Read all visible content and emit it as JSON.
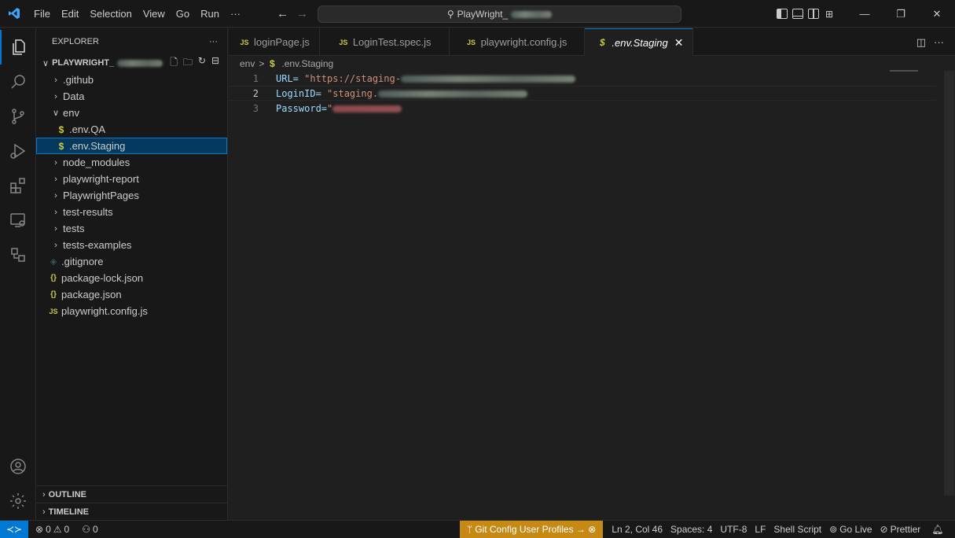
{
  "titlebar": {
    "menu": [
      "File",
      "Edit",
      "Selection",
      "View",
      "Go",
      "Run",
      "···"
    ],
    "search_text": "PlayWright_"
  },
  "sidebar": {
    "header": "EXPLORER",
    "header_more": "···",
    "project_name": "PLAYWRIGHT_",
    "tree": [
      {
        "label": ".github",
        "kind": "folder",
        "expanded": false
      },
      {
        "label": "Data",
        "kind": "folder",
        "expanded": false
      },
      {
        "label": "env",
        "kind": "folder",
        "expanded": true
      },
      {
        "label": ".env.QA",
        "kind": "env-file"
      },
      {
        "label": ".env.Staging",
        "kind": "env-file",
        "selected": true
      },
      {
        "label": "node_modules",
        "kind": "folder",
        "expanded": false
      },
      {
        "label": "playwright-report",
        "kind": "folder",
        "expanded": false
      },
      {
        "label": "PlaywrightPages",
        "kind": "folder",
        "expanded": false
      },
      {
        "label": "test-results",
        "kind": "folder",
        "expanded": false
      },
      {
        "label": "tests",
        "kind": "folder",
        "expanded": false
      },
      {
        "label": "tests-examples",
        "kind": "folder",
        "expanded": false
      },
      {
        "label": ".gitignore",
        "kind": "git-file"
      },
      {
        "label": "package-lock.json",
        "kind": "json-file"
      },
      {
        "label": "package.json",
        "kind": "json-file"
      },
      {
        "label": "playwright.config.js",
        "kind": "js-file"
      }
    ],
    "outline": "OUTLINE",
    "timeline": "TIMELINE"
  },
  "tabs": [
    {
      "label": "loginPage.js",
      "icon": "JS"
    },
    {
      "label": "LoginTest.spec.js",
      "icon": "JS"
    },
    {
      "label": "playwright.config.js",
      "icon": "JS"
    },
    {
      "label": ".env.Staging",
      "icon": "$",
      "active": true
    }
  ],
  "breadcrumb": {
    "folder": "env",
    "separator": ">",
    "file": ".env.Staging"
  },
  "code": [
    {
      "num": "1",
      "key": "URL= ",
      "value": "\"https://staging-"
    },
    {
      "num": "2",
      "key": "LoginID= ",
      "value": "\"staging."
    },
    {
      "num": "3",
      "key": "Password=",
      "value": "\""
    }
  ],
  "statusbar": {
    "errors": "0",
    "warnings": "0",
    "ports": "0",
    "git_profile": "Git Config User Profiles → ⊗",
    "cursor": "Ln 2, Col 46",
    "spaces": "Spaces: 4",
    "encoding": "UTF-8",
    "eol": "LF",
    "language": "Shell Script",
    "golive": "Go Live",
    "prettier": "Prettier"
  }
}
